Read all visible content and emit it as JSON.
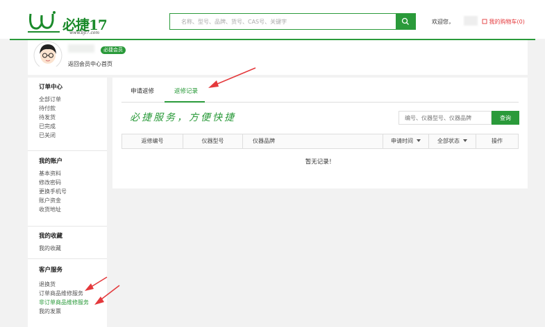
{
  "header": {
    "logo_text": "必捷17",
    "logo_url": "www.bjt7.com",
    "search_placeholder": "名称、型号、品牌、货号、CAS号、关键字",
    "welcome": "欢迎您，",
    "cart": "我的购物车(0)"
  },
  "user": {
    "badge": "必捷会员",
    "back_link": "返回会员中心首页"
  },
  "sidebar": {
    "groups": [
      {
        "title": "订单中心",
        "items": [
          "全部订单",
          "待付款",
          "待发货",
          "已完成",
          "已关闭"
        ]
      },
      {
        "title": "我的账户",
        "items": [
          "基本资料",
          "修改密码",
          "更换手机号",
          "账户资金",
          "收货地址"
        ]
      },
      {
        "title": "我的收藏",
        "items": [
          "我的收藏"
        ]
      },
      {
        "title": "客户服务",
        "items": [
          "退换货",
          "订单商品维修服务",
          "非订单商品维修服务",
          "我的发票"
        ]
      }
    ]
  },
  "main": {
    "tabs": [
      "申请返修",
      "返修记录"
    ],
    "slogan": "必捷服务，方便快捷",
    "query_placeholder": "编号、仪器型号、仪器品牌",
    "query_button": "查询",
    "columns": [
      "返修编号",
      "仪器型号",
      "仪器品牌",
      "申请时间",
      "全部状态",
      "操作"
    ],
    "empty_text": "暂无记录！"
  },
  "colors": {
    "brand": "#2a9a3a",
    "cart": "#e4393c",
    "annotation_arrow": "#e4393c"
  }
}
